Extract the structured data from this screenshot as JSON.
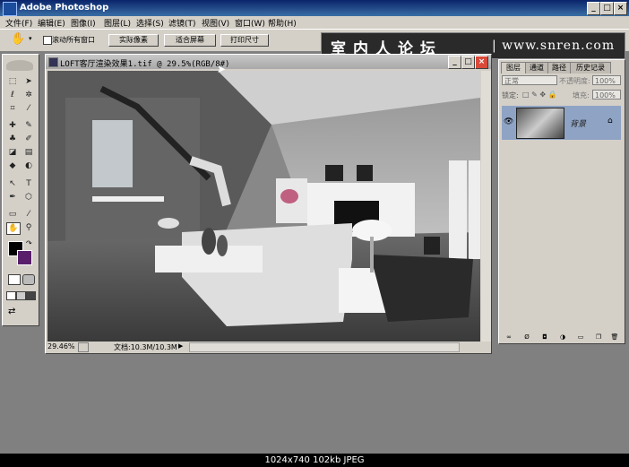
{
  "app": {
    "title": "Adobe Photoshop"
  },
  "menu": {
    "items": [
      "文件(F)",
      "编辑(E)",
      "图像(I)",
      "图层(L)",
      "选择(S)",
      "滤镜(T)",
      "视图(V)",
      "窗口(W)",
      "帮助(H)"
    ]
  },
  "options": {
    "scroll_all": "滚动所有窗口",
    "actual_pixels": "实际像素",
    "fit_screen": "适合屏幕",
    "print_size": "打印尺寸"
  },
  "banner": {
    "title": "室内人论坛",
    "url": "| www.snren.com"
  },
  "document": {
    "title": "LOFT客厅渲染效果1.tif @ 29.5%(RGB/8#)",
    "zoom": "29.46%",
    "doc_info": "文档:10.3M/10.3M"
  },
  "layers": {
    "tabs": [
      "图层",
      "通道",
      "路径",
      "历史记录"
    ],
    "blend_mode": "正常",
    "opacity_label": "不透明度:",
    "opacity_value": "100%",
    "lock_label": "锁定:",
    "fill_label": "填充:",
    "fill_value": "100%",
    "layer_name": "背景"
  },
  "caption": {
    "text": "1024x740 102kb JPEG"
  }
}
